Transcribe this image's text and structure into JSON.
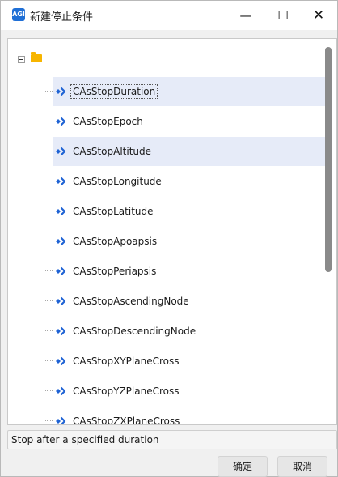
{
  "window": {
    "title": "新建停止条件",
    "icon_text": "AGI",
    "minimize": "—",
    "maximize": "☐",
    "close": "✕"
  },
  "tree": {
    "root_label": "",
    "items": [
      {
        "label": "CAsStopDuration",
        "state": "focused"
      },
      {
        "label": "CAsStopEpoch",
        "state": "normal"
      },
      {
        "label": "CAsStopAltitude",
        "state": "highlighted"
      },
      {
        "label": "CAsStopLongitude",
        "state": "normal"
      },
      {
        "label": "CAsStopLatitude",
        "state": "normal"
      },
      {
        "label": "CAsStopApoapsis",
        "state": "normal"
      },
      {
        "label": "CAsStopPeriapsis",
        "state": "normal"
      },
      {
        "label": "CAsStopAscendingNode",
        "state": "normal"
      },
      {
        "label": "CAsStopDescendingNode",
        "state": "normal"
      },
      {
        "label": "CAsStopXYPlaneCross",
        "state": "normal"
      },
      {
        "label": "CAsStopYZPlaneCross",
        "state": "normal"
      },
      {
        "label": "CAsStopZXPlaneCross",
        "state": "normal"
      }
    ]
  },
  "status": {
    "text": "Stop after a specified duration"
  },
  "buttons": {
    "ok": "确定",
    "cancel": "取消"
  },
  "colors": {
    "diamond": "#1f63d4",
    "arrow": "#1f63d4",
    "folder": "#f7b500",
    "highlight": "#e6ebf8"
  }
}
